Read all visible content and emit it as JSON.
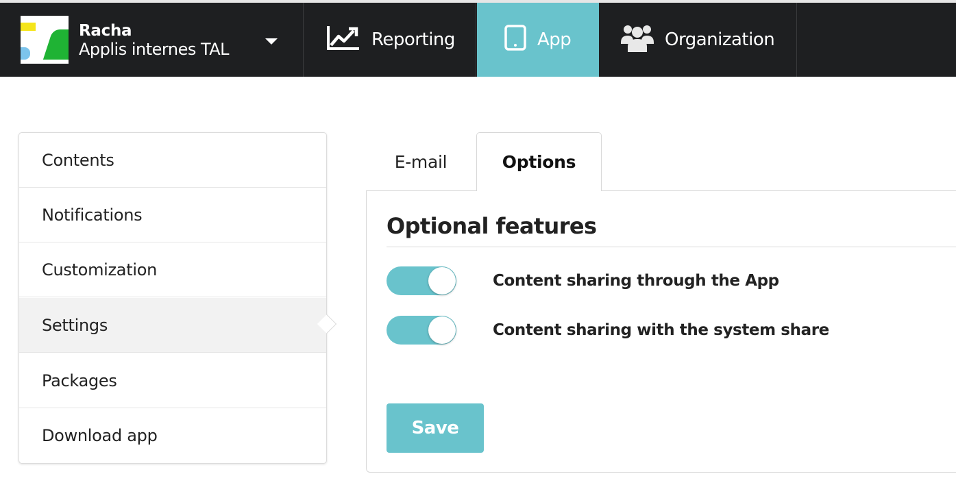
{
  "header": {
    "org_name": "Racha",
    "org_subtitle": "Applis internes TAL",
    "nav": [
      {
        "label": "Reporting",
        "icon": "line-chart-icon"
      },
      {
        "label": "App",
        "icon": "tablet-icon",
        "active": true
      },
      {
        "label": "Organization",
        "icon": "users-icon"
      }
    ]
  },
  "sidebar": {
    "items": [
      {
        "label": "Contents"
      },
      {
        "label": "Notifications"
      },
      {
        "label": "Customization"
      },
      {
        "label": "Settings",
        "active": true
      },
      {
        "label": "Packages"
      },
      {
        "label": "Download app"
      }
    ]
  },
  "tabs": [
    {
      "label": "E-mail"
    },
    {
      "label": "Options",
      "active": true
    }
  ],
  "panel": {
    "title": "Optional features",
    "toggles": [
      {
        "label": "Content sharing through the App",
        "on": true
      },
      {
        "label": "Content sharing with the system share",
        "on": true
      }
    ],
    "save_label": "Save"
  },
  "colors": {
    "accent": "#69c3cc",
    "topbar": "#1e1f21",
    "active_sidebar": "#f2f2f2"
  }
}
